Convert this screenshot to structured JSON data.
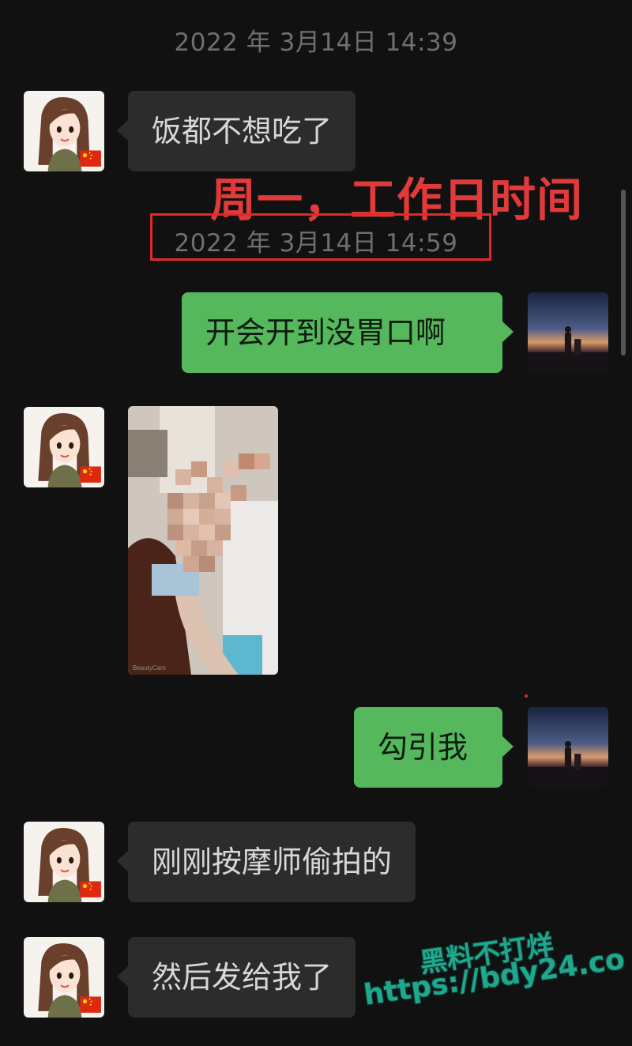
{
  "timestamps": [
    "2022 年 3月14日 14:39",
    "2022 年 3月14日 14:59"
  ],
  "annotation": "周一，工作日时间",
  "messages": {
    "m1": "饭都不想吃了",
    "m2": "开会开到没胃口啊",
    "m4": "勾引我",
    "m5": "刚刚按摩师偷拍的",
    "m6": "然后发给我了"
  },
  "photo_caption": "BeautyCam",
  "watermark": {
    "title": "黑料不打烊",
    "url": "https://bdy24.co"
  },
  "icons": {
    "contact_avatar": "cartoon-woman-avatar",
    "contact_badge": "china-flag-icon",
    "self_avatar": "sunset-silhouette-avatar"
  },
  "colors": {
    "background": "#111111",
    "incoming_bubble": "#2c2c2c",
    "outgoing_bubble": "#55b85c",
    "annotation": "#e23a3a",
    "watermark": "#1fa88e"
  }
}
